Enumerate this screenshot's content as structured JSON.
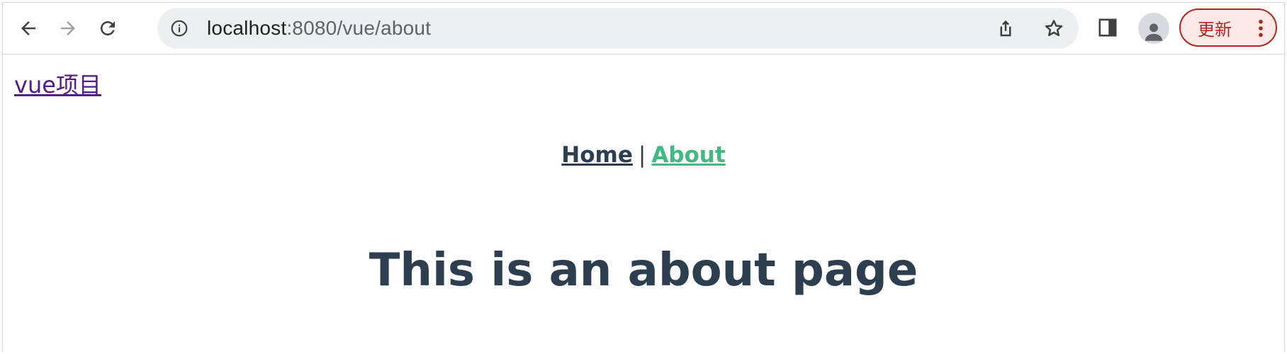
{
  "browser": {
    "url_host": "localhost",
    "url_rest": ":8080/vue/about",
    "update_label": "更新",
    "colors": {
      "omnibox_bg": "#edf0f2",
      "update_accent": "#b3261e"
    },
    "icons": [
      "back-icon",
      "forward-icon",
      "reload-icon",
      "info-icon",
      "share-icon",
      "star-icon",
      "side-panel-icon",
      "avatar-icon",
      "more-vert-icon"
    ]
  },
  "page": {
    "top_link": "vue项目",
    "nav": {
      "home": "Home",
      "separator": "|",
      "about": "About"
    },
    "heading": "This is an about page",
    "colors": {
      "text": "#2c3e50",
      "active_link": "#42b983",
      "visited_link": "#551a8b"
    }
  }
}
